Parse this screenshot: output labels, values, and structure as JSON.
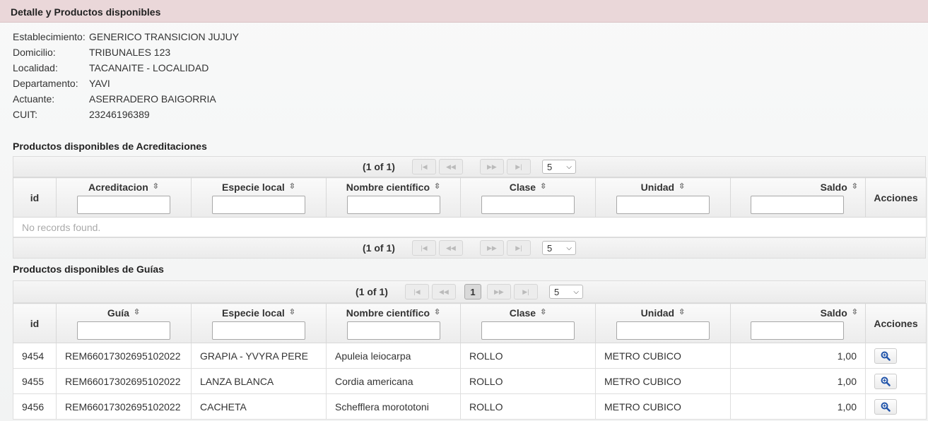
{
  "panel": {
    "title": "Detalle y Productos disponibles"
  },
  "info": [
    {
      "label": "Establecimiento:",
      "value": "GENERICO TRANSICION JUJUY"
    },
    {
      "label": "Domicilio:",
      "value": "TRIBUNALES 123"
    },
    {
      "label": "Localidad:",
      "value": "TACANAITE - LOCALIDAD"
    },
    {
      "label": "Departamento:",
      "value": "YAVI"
    },
    {
      "label": "Actuante:",
      "value": "ASERRADERO BAIGORRIA"
    },
    {
      "label": "CUIT:",
      "value": "23246196389"
    }
  ],
  "acreditaciones": {
    "title": "Productos disponibles de Acreditaciones",
    "page_report": "(1 of 1)",
    "rows_per_page": "5",
    "columns": [
      "id",
      "Acreditacion",
      "Especie local",
      "Nombre científico",
      "Clase",
      "Unidad",
      "Saldo",
      "Acciones"
    ],
    "empty_message": "No records found."
  },
  "guias": {
    "title": "Productos disponibles de Guías",
    "page_report": "(1 of 1)",
    "current_page": "1",
    "rows_per_page": "5",
    "columns": [
      "id",
      "Guía",
      "Especie local",
      "Nombre científico",
      "Clase",
      "Unidad",
      "Saldo",
      "Acciones"
    ],
    "rows": [
      {
        "id": "9454",
        "guia": "REM66017302695102022",
        "especie": "GRAPIA - YVYRA PERE",
        "nombre": "Apuleia leiocarpa",
        "clase": "ROLLO",
        "unidad": "METRO CUBICO",
        "saldo": "1,00"
      },
      {
        "id": "9455",
        "guia": "REM66017302695102022",
        "especie": "LANZA BLANCA",
        "nombre": "Cordia americana",
        "clase": "ROLLO",
        "unidad": "METRO CUBICO",
        "saldo": "1,00"
      },
      {
        "id": "9456",
        "guia": "REM66017302695102022",
        "especie": "CACHETA",
        "nombre": "Schefflera morototoni",
        "clase": "ROLLO",
        "unidad": "METRO CUBICO",
        "saldo": "1,00"
      }
    ]
  },
  "icons": {
    "sort": "sort-icon",
    "first": "first-page-icon",
    "prev": "prev-page-icon",
    "next": "next-page-icon",
    "last": "last-page-icon",
    "view": "zoom-icon",
    "dropdown": "chevron-down-icon"
  },
  "colors": {
    "header_bg": "#ead7d9",
    "view_icon": "#2255aa"
  }
}
